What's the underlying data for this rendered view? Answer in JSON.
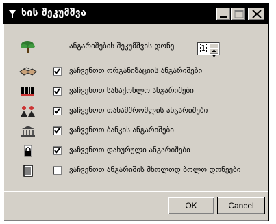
{
  "window": {
    "title": "ხის შეკუმშვა",
    "title_icon": "funnel-icon",
    "controls": [
      "minimize-icon",
      "maximize-icon",
      "close-icon"
    ]
  },
  "level_row": {
    "label": "ანგარიშების შეკუმშვის დონე",
    "icon": "tree-icon",
    "value": "1"
  },
  "options": [
    {
      "label": "ვაჩვენოთ ორგანიზაციის ანგარიშები",
      "icon": "handshake-icon",
      "checked": true
    },
    {
      "label": "ვაჩვენოთ სასაქონლო ანგარიშები",
      "icon": "barcode-icon",
      "checked": true
    },
    {
      "label": "ვაჩვენოთ თანამშრომლის ანგარიშები",
      "icon": "people-icon",
      "checked": true
    },
    {
      "label": "ვაჩვენოთ ბანკის ანგარიშები",
      "icon": "bank-icon",
      "checked": true
    },
    {
      "label": "ვაჩვენოთ დახურული ანგარიშები",
      "icon": "lock-icon",
      "checked": true
    },
    {
      "label": "ვაჩვენოთ ანგარიშის მხოლოდ ბოლო დონეები",
      "icon": "ledger-icon",
      "checked": false
    }
  ],
  "buttons": {
    "ok": "OK",
    "cancel": "Cancel"
  }
}
